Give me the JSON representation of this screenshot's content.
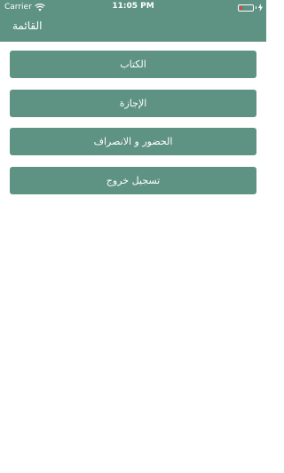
{
  "status_bar": {
    "carrier": "Carrier",
    "time": "11:05 PM",
    "battery_color": "#e0443a"
  },
  "header": {
    "title": "القائمة",
    "background": "#5e9282"
  },
  "menu": {
    "items": [
      {
        "label": "الكتاب"
      },
      {
        "label": "الإجازة"
      },
      {
        "label": "الحضور و الانصراف"
      },
      {
        "label": "تسجيل خروج"
      }
    ]
  },
  "colors": {
    "accent": "#5e9282",
    "text_on_accent": "#ffffff",
    "background": "#ffffff"
  },
  "icons": [
    "wifi-icon",
    "battery-icon",
    "charging-bolt-icon"
  ]
}
